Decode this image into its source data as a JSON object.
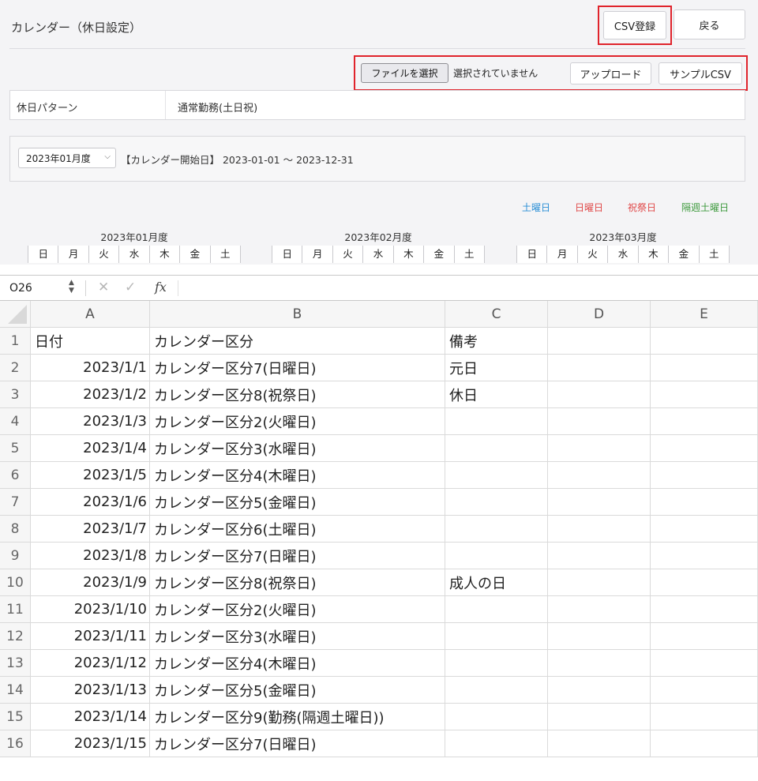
{
  "app": {
    "title": "カレンダー（休日設定）",
    "csv_register_label": "CSV登録",
    "back_label": "戻る",
    "file_choose_label": "ファイルを選択",
    "file_status": "選択されていません",
    "upload_label": "アップロード",
    "sample_csv_label": "サンプルCSV",
    "holiday_pattern_label": "休日パターン",
    "holiday_pattern_value": "通常勤務(土日祝)",
    "period_select_value": "2023年01月度",
    "range_text": "【カレンダー開始日】 2023-01-01 〜 2023-12-31",
    "legend": [
      {
        "label": "土曜日",
        "color": "#2b8fd6"
      },
      {
        "label": "日曜日",
        "color": "#e04848"
      },
      {
        "label": "祝祭日",
        "color": "#e04848"
      },
      {
        "label": "隔週土曜日",
        "color": "#3e9a3e"
      }
    ],
    "months": [
      "2023年01月度",
      "2023年02月度",
      "2023年03月度"
    ],
    "weekdays": [
      "日",
      "月",
      "火",
      "水",
      "木",
      "金",
      "土"
    ]
  },
  "sheet": {
    "cell_ref": "O26",
    "formula_icon": "fx",
    "columns": [
      "A",
      "B",
      "C",
      "D",
      "E"
    ],
    "rows": [
      {
        "n": "1",
        "a": "日付",
        "b": "カレンダー区分",
        "c": "備考"
      },
      {
        "n": "2",
        "a": "2023/1/1",
        "b": "カレンダー区分7(日曜日)",
        "c": "元日"
      },
      {
        "n": "3",
        "a": "2023/1/2",
        "b": "カレンダー区分8(祝祭日)",
        "c": "休日"
      },
      {
        "n": "4",
        "a": "2023/1/3",
        "b": "カレンダー区分2(火曜日)",
        "c": ""
      },
      {
        "n": "5",
        "a": "2023/1/4",
        "b": "カレンダー区分3(水曜日)",
        "c": ""
      },
      {
        "n": "6",
        "a": "2023/1/5",
        "b": "カレンダー区分4(木曜日)",
        "c": ""
      },
      {
        "n": "7",
        "a": "2023/1/6",
        "b": "カレンダー区分5(金曜日)",
        "c": ""
      },
      {
        "n": "8",
        "a": "2023/1/7",
        "b": "カレンダー区分6(土曜日)",
        "c": ""
      },
      {
        "n": "9",
        "a": "2023/1/8",
        "b": "カレンダー区分7(日曜日)",
        "c": ""
      },
      {
        "n": "10",
        "a": "2023/1/9",
        "b": "カレンダー区分8(祝祭日)",
        "c": "成人の日"
      },
      {
        "n": "11",
        "a": "2023/1/10",
        "b": "カレンダー区分2(火曜日)",
        "c": ""
      },
      {
        "n": "12",
        "a": "2023/1/11",
        "b": "カレンダー区分3(水曜日)",
        "c": ""
      },
      {
        "n": "13",
        "a": "2023/1/12",
        "b": "カレンダー区分4(木曜日)",
        "c": ""
      },
      {
        "n": "14",
        "a": "2023/1/13",
        "b": "カレンダー区分5(金曜日)",
        "c": ""
      },
      {
        "n": "15",
        "a": "2023/1/14",
        "b": "カレンダー区分9(勤務(隔週土曜日))",
        "c": ""
      },
      {
        "n": "16",
        "a": "2023/1/15",
        "b": "カレンダー区分7(日曜日)",
        "c": ""
      }
    ]
  }
}
